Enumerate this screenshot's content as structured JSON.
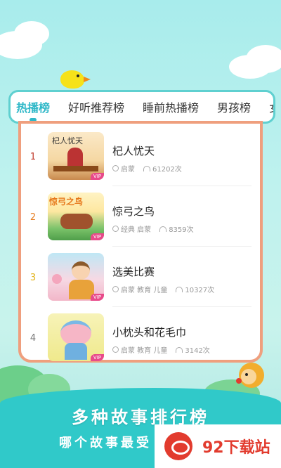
{
  "tabs": [
    {
      "label": "热播榜",
      "active": true
    },
    {
      "label": "好听推荐榜",
      "active": false
    },
    {
      "label": "睡前热播榜",
      "active": false
    },
    {
      "label": "男孩榜",
      "active": false
    },
    {
      "label": "女",
      "active": false
    }
  ],
  "stories": [
    {
      "rank": "1",
      "title": "杞人忧天",
      "tags": "启蒙",
      "plays": "61202次",
      "thumb_text": "杞人忧天",
      "rank_color": "#c0392b"
    },
    {
      "rank": "2",
      "title": "惊弓之鸟",
      "tags": "经典 启蒙",
      "plays": "8359次",
      "thumb_text": "惊弓之鸟",
      "rank_color": "#e67e22"
    },
    {
      "rank": "3",
      "title": "选美比赛",
      "tags": "启蒙 教育 儿童",
      "plays": "10327次",
      "thumb_text": "",
      "rank_color": "#e2b31b"
    },
    {
      "rank": "4",
      "title": "小枕头和花毛巾",
      "tags": "启蒙 教育 儿童",
      "plays": "3142次",
      "thumb_text": "",
      "rank_color": "#777777"
    }
  ],
  "vip_label": "VIP",
  "banner": {
    "line1": "多种故事排行榜",
    "line2": "哪个故事最受"
  },
  "watermark": {
    "text": "92下载站"
  },
  "colors": {
    "accent": "#2fb8c8",
    "panel_border": "#ef9f7e",
    "vip": "#e84a8a"
  }
}
